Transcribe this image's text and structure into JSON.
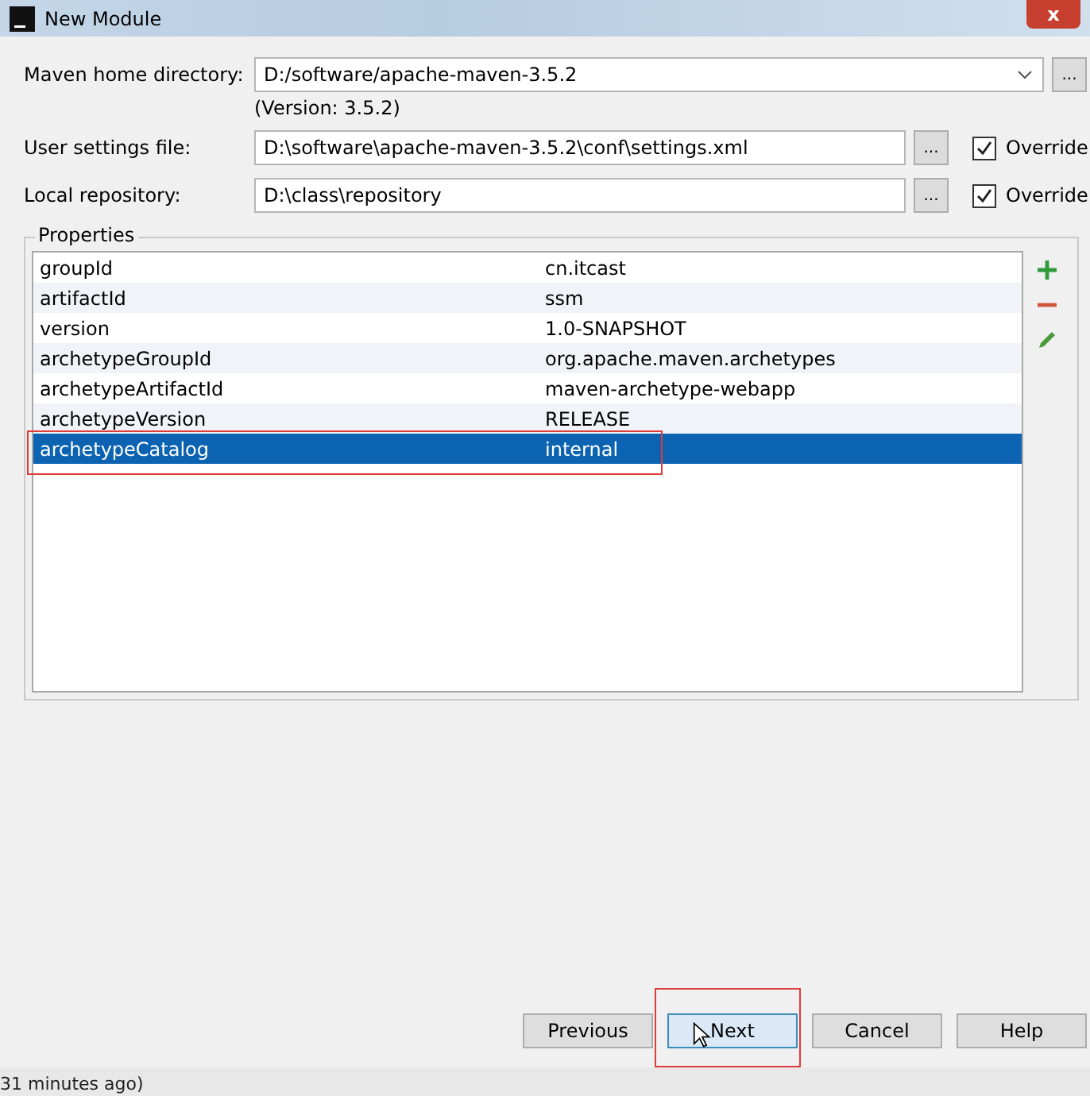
{
  "window": {
    "title": "New Module",
    "close": "x"
  },
  "maven_home": {
    "label": "Maven home directory:",
    "value": "D:/software/apache-maven-3.5.2",
    "browse": "...",
    "version": "(Version: 3.5.2)"
  },
  "settings_rows": [
    {
      "label": "User settings file:",
      "value": "D:\\software\\apache-maven-3.5.2\\conf\\settings.xml",
      "browse": "...",
      "override": {
        "label": "Override",
        "checked": true
      }
    },
    {
      "label": "Local repository:",
      "value": "D:\\class\\repository",
      "browse": "...",
      "override": {
        "label": "Override",
        "checked": true
      }
    }
  ],
  "properties": {
    "title": "Properties",
    "rows": [
      {
        "name": "groupId",
        "value": "cn.itcast",
        "selected": false,
        "annotated": false
      },
      {
        "name": "artifactId",
        "value": "ssm",
        "selected": false,
        "annotated": false
      },
      {
        "name": "version",
        "value": "1.0-SNAPSHOT",
        "selected": false,
        "annotated": false
      },
      {
        "name": "archetypeGroupId",
        "value": "org.apache.maven.archetypes",
        "selected": false,
        "annotated": false
      },
      {
        "name": "archetypeArtifactId",
        "value": "maven-archetype-webapp",
        "selected": false,
        "annotated": false
      },
      {
        "name": "archetypeVersion",
        "value": "RELEASE",
        "selected": false,
        "annotated": false
      },
      {
        "name": "archetypeCatalog",
        "value": "internal",
        "selected": true,
        "annotated": true
      }
    ]
  },
  "buttons": [
    {
      "label": "Previous",
      "focused": false,
      "annotated": false
    },
    {
      "label": "Next",
      "focused": true,
      "annotated": true
    },
    {
      "label": "Cancel",
      "focused": false,
      "annotated": false
    },
    {
      "label": "Help",
      "focused": false,
      "annotated": false
    }
  ],
  "background_text": "31 minutes ago)"
}
